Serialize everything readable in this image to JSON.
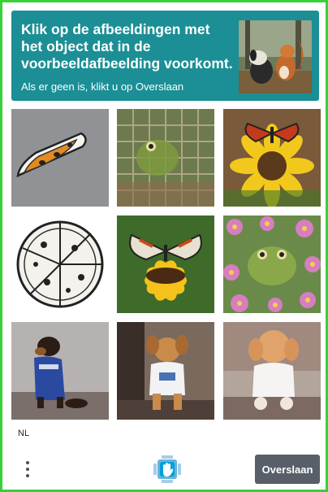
{
  "challenge": {
    "prompt": "Klik op de afbeeldingen met het object dat in de voorbeeldafbeelding voorkomt.",
    "subprompt": "Als er geen is, klikt u op Overslaan",
    "example_icon": "squirrel-and-dog-example-image"
  },
  "tiles": [
    {
      "icon": "pizza-slice-drawing"
    },
    {
      "icon": "frog-grid-pattern"
    },
    {
      "icon": "butterfly-on-sunflower"
    },
    {
      "icon": "pizza-drawing"
    },
    {
      "icon": "butterfly-on-sunflower"
    },
    {
      "icon": "frog-in-flowers"
    },
    {
      "icon": "dog-in-blue-shirt"
    },
    {
      "icon": "puppy-in-white-shirt"
    },
    {
      "icon": "poodle-in-white-shirt"
    }
  ],
  "footer": {
    "language": "NL",
    "skip_label": "Overslaan",
    "menu_icon": "more-vertical-icon",
    "logo_icon": "hcaptcha-hand-logo"
  },
  "colors": {
    "header_bg": "#1b8f95",
    "frame_border": "#38d13a",
    "skip_bg": "#585f68"
  }
}
